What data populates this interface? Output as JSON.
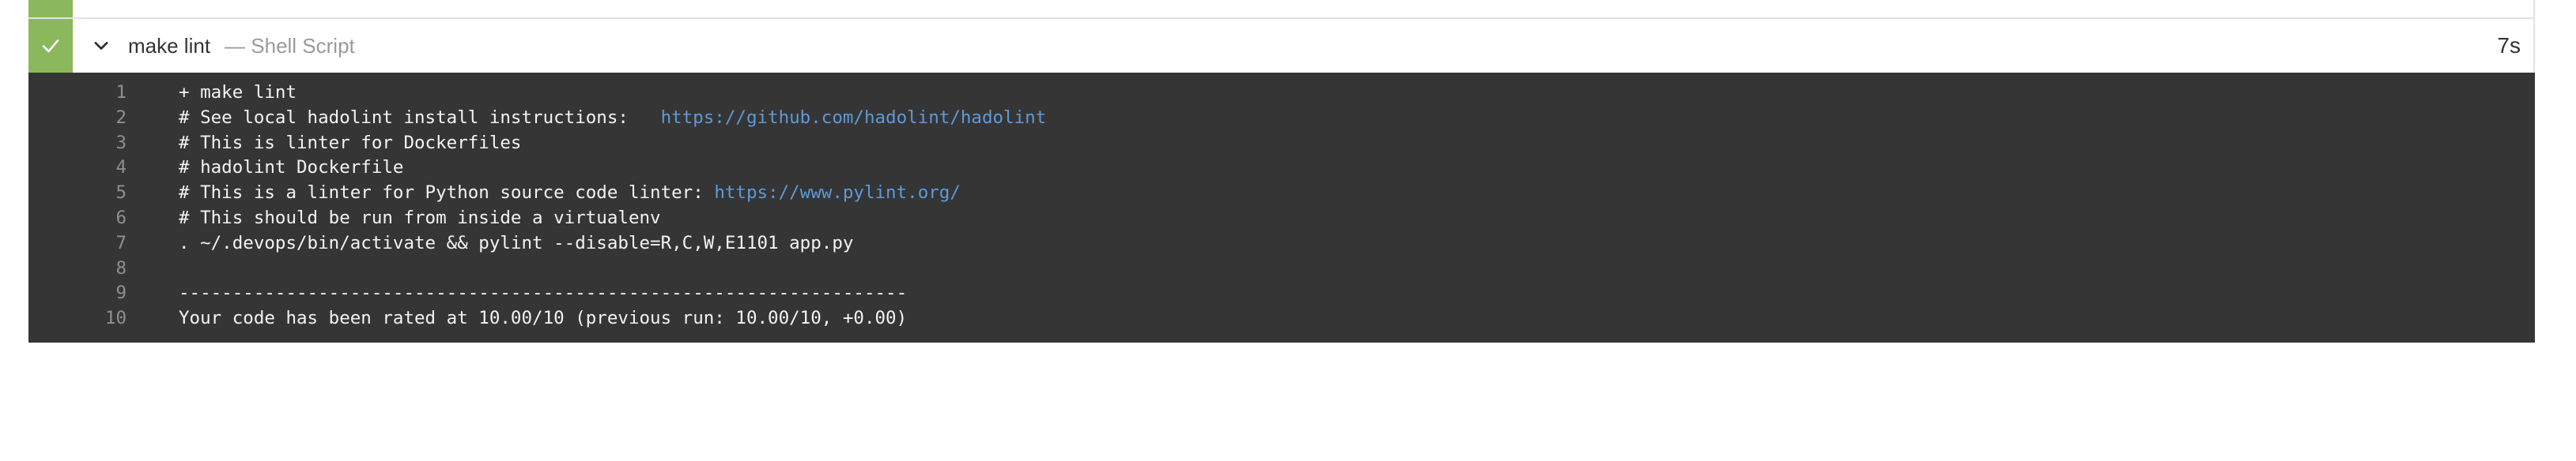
{
  "step": {
    "status": "success",
    "status_icon": "check-icon",
    "toggle_icon": "chevron-down-icon",
    "title": "make lint",
    "subtitle": "— Shell Script",
    "duration": "7s",
    "colors": {
      "success": "#8bb85c",
      "log_bg": "#353535",
      "link": "#5d9ad9"
    }
  },
  "log": {
    "lines": [
      {
        "no": "1",
        "text": "+ make lint",
        "link": ""
      },
      {
        "no": "2",
        "text": "# See local hadolint install instructions:   ",
        "link": "https://github.com/hadolint/hadolint"
      },
      {
        "no": "3",
        "text": "# This is linter for Dockerfiles",
        "link": ""
      },
      {
        "no": "4",
        "text": "# hadolint Dockerfile",
        "link": ""
      },
      {
        "no": "5",
        "text": "# This is a linter for Python source code linter: ",
        "link": "https://www.pylint.org/"
      },
      {
        "no": "6",
        "text": "# This should be run from inside a virtualenv",
        "link": ""
      },
      {
        "no": "7",
        "text": ". ~/.devops/bin/activate && pylint --disable=R,C,W,E1101 app.py",
        "link": ""
      },
      {
        "no": "8",
        "text": "",
        "link": ""
      },
      {
        "no": "9",
        "text": "--------------------------------------------------------------------",
        "link": ""
      },
      {
        "no": "10",
        "text": "Your code has been rated at 10.00/10 (previous run: 10.00/10, +0.00)",
        "link": ""
      }
    ]
  }
}
